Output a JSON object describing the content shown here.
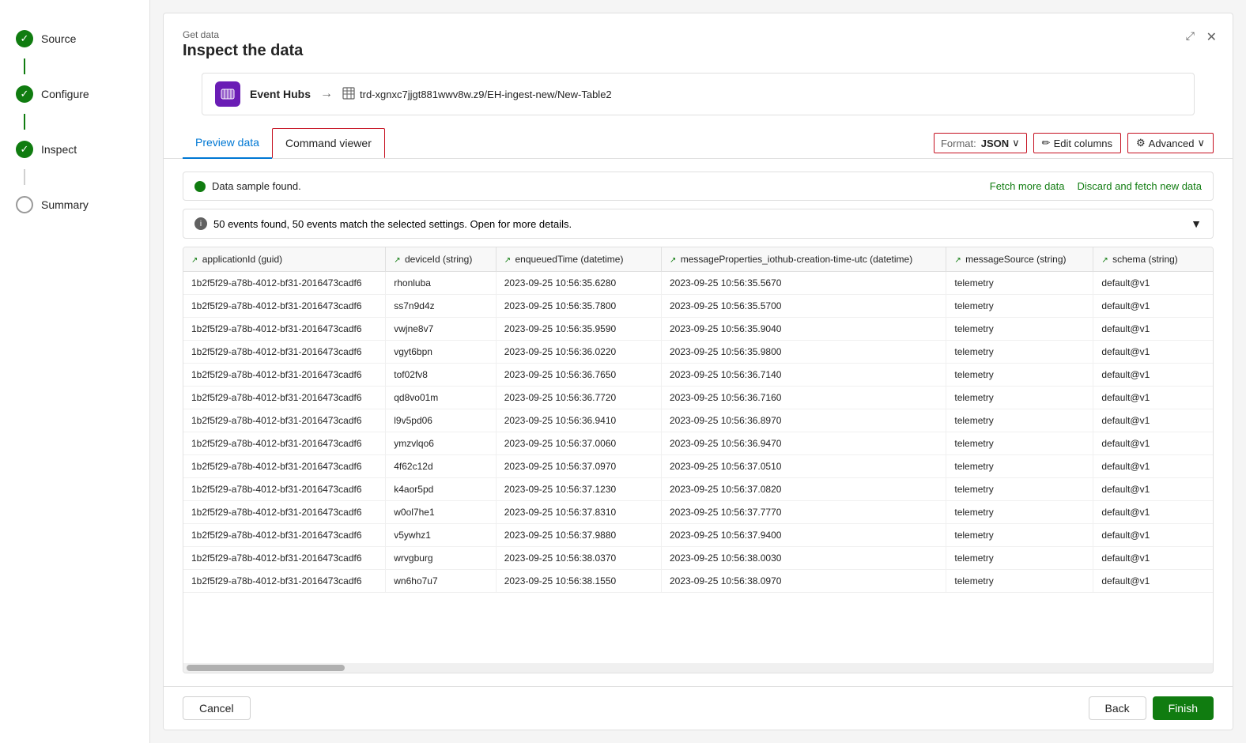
{
  "sidebar": {
    "items": [
      {
        "id": "source",
        "label": "Source",
        "state": "completed"
      },
      {
        "id": "configure",
        "label": "Configure",
        "state": "completed"
      },
      {
        "id": "inspect",
        "label": "Inspect",
        "state": "active"
      },
      {
        "id": "summary",
        "label": "Summary",
        "state": "inactive"
      }
    ]
  },
  "modal": {
    "get_data_label": "Get data",
    "page_title": "Inspect the data",
    "source_name": "Event Hubs",
    "arrow": "→",
    "path": "trd-xgnxc7jjgt881wwv8w.z9/EH-ingest-new/New-Table2",
    "close_icon": "✕",
    "expand_icon": "⤢"
  },
  "tabs": {
    "items": [
      {
        "id": "preview",
        "label": "Preview data",
        "active": true
      },
      {
        "id": "command",
        "label": "Command viewer",
        "active": false
      }
    ]
  },
  "toolbar": {
    "format_label": "Format:",
    "format_value": "JSON",
    "edit_columns_label": "Edit columns",
    "advanced_label": "Advanced",
    "pencil_icon": "✏",
    "gear_icon": "⚙",
    "chevron_down": "∨"
  },
  "status": {
    "sample_found_text": "Data sample found.",
    "fetch_more_label": "Fetch more data",
    "discard_label": "Discard and fetch new data"
  },
  "events_bar": {
    "text": "50 events found, 50 events match the selected settings. Open for more details."
  },
  "table": {
    "columns": [
      {
        "id": "applicationId",
        "label": "applicationId (guid)",
        "width": "220"
      },
      {
        "id": "deviceId",
        "label": "deviceId (string)",
        "width": "120"
      },
      {
        "id": "enqueuedTime",
        "label": "enqueuedTime (datetime)",
        "width": "175"
      },
      {
        "id": "messageProperties",
        "label": "messageProperties_iothub-creation-time-utc (datetime)",
        "width": "310"
      },
      {
        "id": "messageSource",
        "label": "messageSource (string)",
        "width": "155"
      },
      {
        "id": "schema",
        "label": "schema (string)",
        "width": "130"
      }
    ],
    "rows": [
      {
        "applicationId": "1b2f5f29-a78b-4012-bf31-2016473cadf6",
        "deviceId": "rhonluba",
        "enqueuedTime": "2023-09-25 10:56:35.6280",
        "messageProperties": "2023-09-25 10:56:35.5670",
        "messageSource": "telemetry",
        "schema": "default@v1"
      },
      {
        "applicationId": "1b2f5f29-a78b-4012-bf31-2016473cadf6",
        "deviceId": "ss7n9d4z",
        "enqueuedTime": "2023-09-25 10:56:35.7800",
        "messageProperties": "2023-09-25 10:56:35.5700",
        "messageSource": "telemetry",
        "schema": "default@v1"
      },
      {
        "applicationId": "1b2f5f29-a78b-4012-bf31-2016473cadf6",
        "deviceId": "vwjne8v7",
        "enqueuedTime": "2023-09-25 10:56:35.9590",
        "messageProperties": "2023-09-25 10:56:35.9040",
        "messageSource": "telemetry",
        "schema": "default@v1"
      },
      {
        "applicationId": "1b2f5f29-a78b-4012-bf31-2016473cadf6",
        "deviceId": "vgyt6bpn",
        "enqueuedTime": "2023-09-25 10:56:36.0220",
        "messageProperties": "2023-09-25 10:56:35.9800",
        "messageSource": "telemetry",
        "schema": "default@v1"
      },
      {
        "applicationId": "1b2f5f29-a78b-4012-bf31-2016473cadf6",
        "deviceId": "tof02fv8",
        "enqueuedTime": "2023-09-25 10:56:36.7650",
        "messageProperties": "2023-09-25 10:56:36.7140",
        "messageSource": "telemetry",
        "schema": "default@v1"
      },
      {
        "applicationId": "1b2f5f29-a78b-4012-bf31-2016473cadf6",
        "deviceId": "qd8vo01m",
        "enqueuedTime": "2023-09-25 10:56:36.7720",
        "messageProperties": "2023-09-25 10:56:36.7160",
        "messageSource": "telemetry",
        "schema": "default@v1"
      },
      {
        "applicationId": "1b2f5f29-a78b-4012-bf31-2016473cadf6",
        "deviceId": "l9v5pd06",
        "enqueuedTime": "2023-09-25 10:56:36.9410",
        "messageProperties": "2023-09-25 10:56:36.8970",
        "messageSource": "telemetry",
        "schema": "default@v1"
      },
      {
        "applicationId": "1b2f5f29-a78b-4012-bf31-2016473cadf6",
        "deviceId": "ymzvlqo6",
        "enqueuedTime": "2023-09-25 10:56:37.0060",
        "messageProperties": "2023-09-25 10:56:36.9470",
        "messageSource": "telemetry",
        "schema": "default@v1"
      },
      {
        "applicationId": "1b2f5f29-a78b-4012-bf31-2016473cadf6",
        "deviceId": "4f62c12d",
        "enqueuedTime": "2023-09-25 10:56:37.0970",
        "messageProperties": "2023-09-25 10:56:37.0510",
        "messageSource": "telemetry",
        "schema": "default@v1"
      },
      {
        "applicationId": "1b2f5f29-a78b-4012-bf31-2016473cadf6",
        "deviceId": "k4aor5pd",
        "enqueuedTime": "2023-09-25 10:56:37.1230",
        "messageProperties": "2023-09-25 10:56:37.0820",
        "messageSource": "telemetry",
        "schema": "default@v1"
      },
      {
        "applicationId": "1b2f5f29-a78b-4012-bf31-2016473cadf6",
        "deviceId": "w0ol7he1",
        "enqueuedTime": "2023-09-25 10:56:37.8310",
        "messageProperties": "2023-09-25 10:56:37.7770",
        "messageSource": "telemetry",
        "schema": "default@v1"
      },
      {
        "applicationId": "1b2f5f29-a78b-4012-bf31-2016473cadf6",
        "deviceId": "v5ywhz1",
        "enqueuedTime": "2023-09-25 10:56:37.9880",
        "messageProperties": "2023-09-25 10:56:37.9400",
        "messageSource": "telemetry",
        "schema": "default@v1"
      },
      {
        "applicationId": "1b2f5f29-a78b-4012-bf31-2016473cadf6",
        "deviceId": "wrvgburg",
        "enqueuedTime": "2023-09-25 10:56:38.0370",
        "messageProperties": "2023-09-25 10:56:38.0030",
        "messageSource": "telemetry",
        "schema": "default@v1"
      },
      {
        "applicationId": "1b2f5f29-a78b-4012-bf31-2016473cadf6",
        "deviceId": "wn6ho7u7",
        "enqueuedTime": "2023-09-25 10:56:38.1550",
        "messageProperties": "2023-09-25 10:56:38.0970",
        "messageSource": "telemetry",
        "schema": "default@v1"
      }
    ]
  },
  "footer": {
    "cancel_label": "Cancel",
    "back_label": "Back",
    "finish_label": "Finish"
  }
}
